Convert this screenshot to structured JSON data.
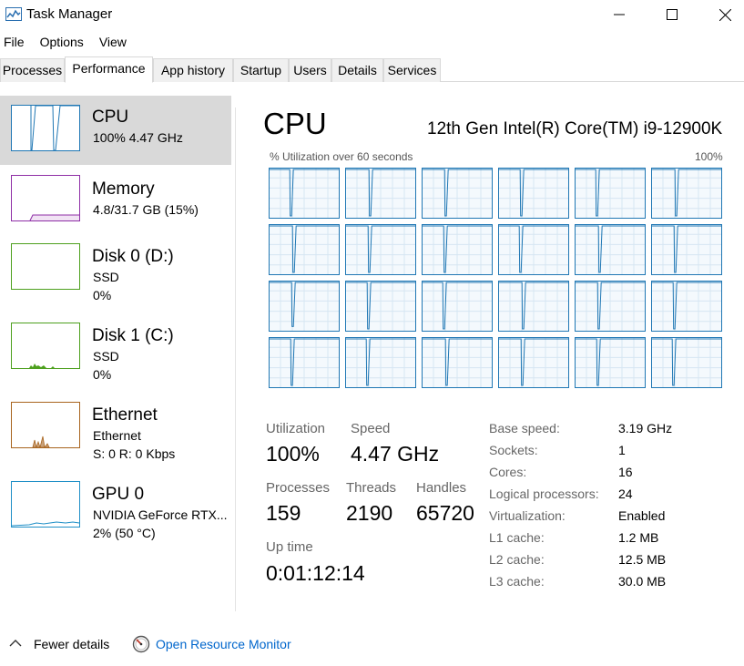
{
  "window": {
    "title": "Task Manager",
    "icon": "task-manager-icon"
  },
  "menu": [
    "File",
    "Options",
    "View"
  ],
  "tabs": [
    "Processes",
    "Performance",
    "App history",
    "Startup",
    "Users",
    "Details",
    "Services"
  ],
  "active_tab": "Performance",
  "sidebar": {
    "items": [
      {
        "title": "CPU",
        "lines": [
          "100%  4.47 GHz"
        ],
        "color": "#1f77b4",
        "selected": true
      },
      {
        "title": "Memory",
        "lines": [
          "4.8/31.7 GB (15%)"
        ],
        "color": "#8e2ea6"
      },
      {
        "title": "Disk 0 (D:)",
        "lines": [
          "SSD",
          "0%"
        ],
        "color": "#4da01e"
      },
      {
        "title": "Disk 1 (C:)",
        "lines": [
          "SSD",
          "0%"
        ],
        "color": "#4da01e"
      },
      {
        "title": "Ethernet",
        "lines": [
          "Ethernet",
          "S: 0  R: 0 Kbps"
        ],
        "color": "#a8641e"
      },
      {
        "title": "GPU 0",
        "lines": [
          "NVIDIA GeForce RTX...",
          "2%  (50 °C)"
        ],
        "color": "#1f8fc7"
      }
    ]
  },
  "main": {
    "heading": "CPU",
    "model": "12th Gen Intel(R) Core(TM) i9-12900K",
    "graph_label": "% Utilization over 60 seconds",
    "graph_max": "100%",
    "grid_rows": 4,
    "grid_cols": 6,
    "stats": {
      "utilization_label": "Utilization",
      "utilization": "100%",
      "speed_label": "Speed",
      "speed": "4.47 GHz",
      "processes_label": "Processes",
      "processes": "159",
      "threads_label": "Threads",
      "threads": "2190",
      "handles_label": "Handles",
      "handles": "65720",
      "uptime_label": "Up time",
      "uptime": "0:01:12:14"
    },
    "specs": [
      {
        "label": "Base speed:",
        "value": "3.19 GHz"
      },
      {
        "label": "Sockets:",
        "value": "1"
      },
      {
        "label": "Cores:",
        "value": "16"
      },
      {
        "label": "Logical processors:",
        "value": "24"
      },
      {
        "label": "Virtualization:",
        "value": "Enabled"
      },
      {
        "label": "L1 cache:",
        "value": "1.2 MB"
      },
      {
        "label": "L2 cache:",
        "value": "12.5 MB"
      },
      {
        "label": "L3 cache:",
        "value": "30.0 MB"
      }
    ]
  },
  "footer": {
    "fewer_details": "Fewer details",
    "resource_monitor": "Open Resource Monitor"
  },
  "colors": {
    "cpu_line": "#1f77b4",
    "cpu_border": "#1f77b4",
    "grid_line": "#d6e6f2",
    "cell_bg": "#f4f9fd",
    "selected_bg": "#d9d9d9",
    "link": "#0066cc"
  }
}
